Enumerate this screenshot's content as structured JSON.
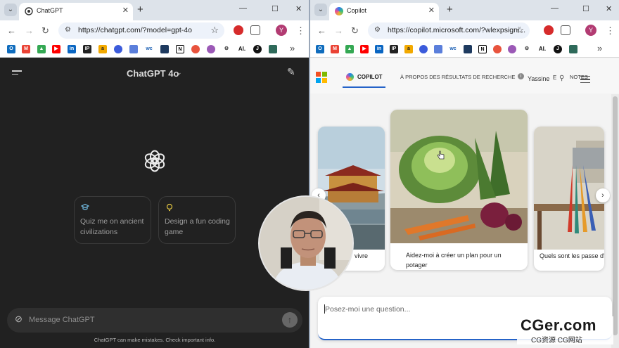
{
  "left": {
    "tab_title": "ChatGPT",
    "url": "https://chatgpt.com/?model=gpt-4o",
    "avatar_letter": "Y",
    "model_label": "ChatGPT 4o",
    "cards": [
      {
        "text": "Quiz me on ancient civilizations",
        "icon": "graduation-cap-icon",
        "color": "#74c0e8"
      },
      {
        "text": "Design a fun coding game",
        "icon": "lightbulb-icon",
        "color": "#e2c541"
      }
    ],
    "composer_placeholder": "Message ChatGPT",
    "disclaimer": "ChatGPT can make mistakes. Check important info."
  },
  "right": {
    "tab_title": "Copilot",
    "url": "https://copilot.microsoft.com/?wlexpsigni...",
    "avatar_letter": "Y",
    "nav": {
      "copilot": "COPILOT",
      "about": "À PROPOS DES RÉSULTATS DE RECHERCHE",
      "user": "Yassine",
      "e": "E",
      "notes": "NOTES"
    },
    "cards": [
      {
        "caption": "vivre"
      },
      {
        "caption": "Aidez-moi à créer un plan pour un potager"
      },
      {
        "caption": "Quels sont les passe d'intérieur faciles à"
      }
    ],
    "input_placeholder": "Posez-moi une question..."
  },
  "watermark": {
    "big": "CGer.com",
    "small": "CG资源  CG网站"
  }
}
